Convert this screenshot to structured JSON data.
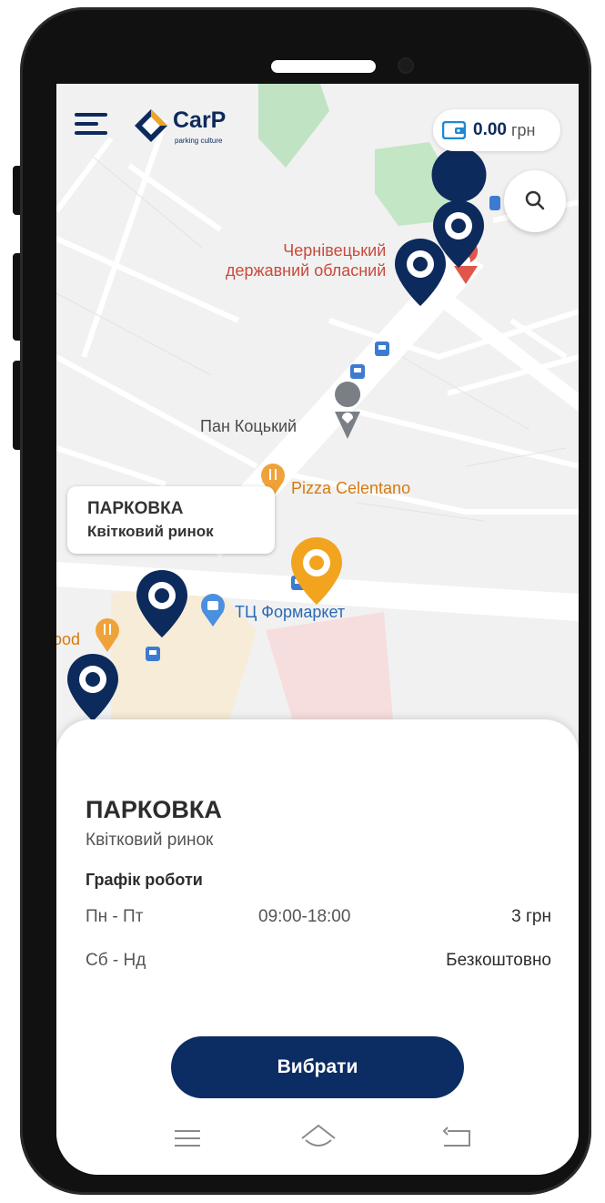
{
  "header": {
    "logo_text": "CarP",
    "logo_tagline": "parking culture",
    "balance_amount": "0.00",
    "balance_currency": "грн"
  },
  "map": {
    "pois": {
      "college": "Чернівецький\nдержавний обласний",
      "pan": "Пан Коцький",
      "pizza": "Pizza Celentano",
      "mall": "ТЦ Формаркет",
      "food_partial": "ood"
    },
    "tooltip": {
      "title": "ПАРКОВКА",
      "subtitle": "Квітковий ринок"
    }
  },
  "details": {
    "title": "ПАРКОВКА",
    "subtitle": "Квітковий ринок",
    "schedule_label": "Графік роботи",
    "schedule": [
      {
        "days": "Пн - Пт",
        "hours": "09:00-18:00",
        "price": "3 грн"
      },
      {
        "days": "Сб - Нд",
        "hours": "",
        "price": "Безкоштовно"
      }
    ],
    "select_label": "Вибрати"
  },
  "colors": {
    "brand_navy": "#0b2d63",
    "marker_navy": "#0d2a5c",
    "marker_selected": "#f2a41f",
    "map_bg": "#f1f1f1"
  },
  "icons": {
    "menu": "hamburger-icon",
    "wallet": "wallet-icon",
    "search": "search-icon",
    "nav_recent": "menu-lines-icon",
    "nav_home": "home-icon",
    "nav_back": "back-icon"
  }
}
